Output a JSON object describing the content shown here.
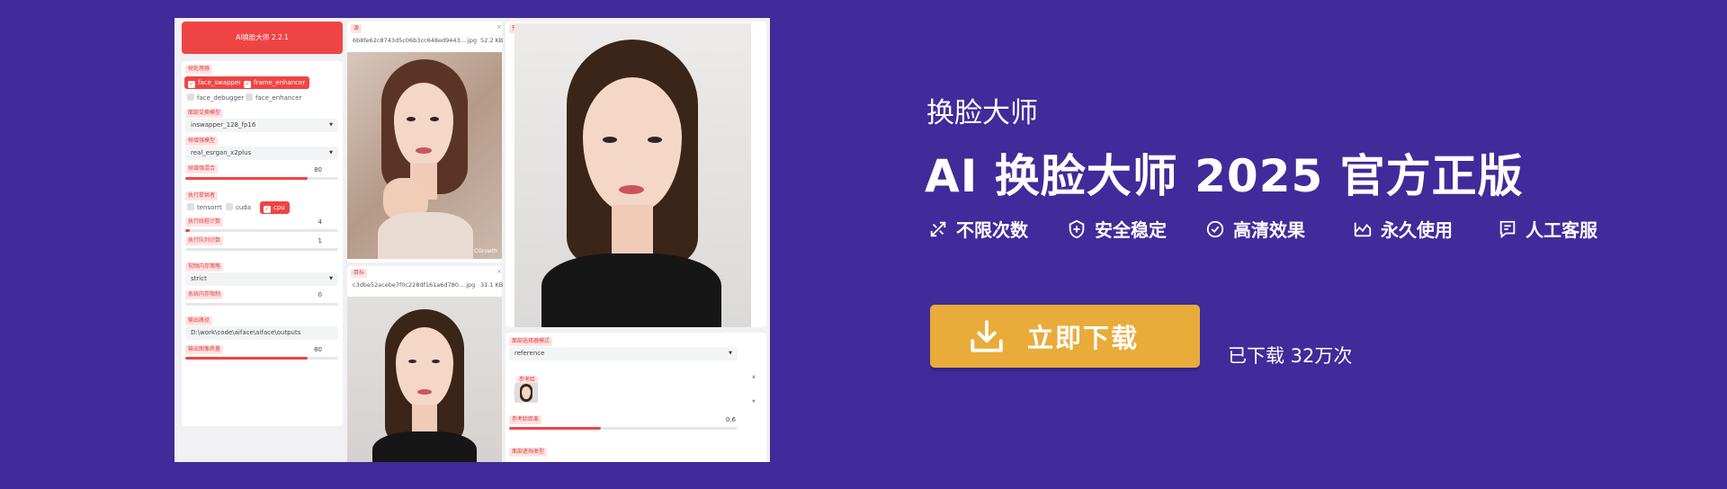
{
  "app": {
    "title": "AI换脸大师 2.2.1",
    "processors": {
      "label": "帧处理器",
      "items": [
        {
          "name": "face_swapper",
          "checked": true
        },
        {
          "name": "frame_enhancer",
          "checked": true
        },
        {
          "name": "face_debugger",
          "checked": false
        },
        {
          "name": "face_enhancer",
          "checked": false
        }
      ]
    },
    "swapper_model": {
      "label": "面部交换模型",
      "value": "inswapper_128_fp16"
    },
    "enhancer_model": {
      "label": "帧增强模型",
      "value": "real_esrgan_x2plus"
    },
    "enhancer_blend": {
      "label": "帧增强混合",
      "value": "80",
      "fraction": 0.8
    },
    "providers": {
      "label": "执行提供者",
      "items": [
        {
          "name": "tensorrt",
          "checked": false
        },
        {
          "name": "cuda",
          "checked": false
        },
        {
          "name": "cpu",
          "checked": true
        }
      ]
    },
    "thread_count": {
      "label": "执行线程计数",
      "value": "4",
      "fraction": 0.03
    },
    "queue_count": {
      "label": "执行队列计数",
      "value": "1",
      "fraction": 0.0
    },
    "memory_strategy": {
      "label": "视频内存策略",
      "value": "strict"
    },
    "memory_limit": {
      "label": "系统内存限制",
      "value": "0",
      "fraction": 0.0
    },
    "output_path": {
      "label": "输出路径",
      "value": "D:\\work\\code\\aiface\\aiface\\outputs"
    },
    "output_quality": {
      "label": "输出图像质量",
      "value": "80",
      "fraction": 0.8
    },
    "source": {
      "label": "源",
      "filename": "6b8fe62c8743d5c06b3cc648ed9443....jpg",
      "size": "52.2 KB"
    },
    "target": {
      "label": "目标",
      "filename": "c3dbe52acebe7f0c228df161a6d780....jpg",
      "size": "31.1 KB"
    },
    "preview": {
      "label": "预览"
    },
    "face_selector": {
      "label": "面部选择器模式",
      "value": "reference"
    },
    "reference": {
      "label": "参考脸"
    },
    "ref_distance": {
      "label": "参考脸距离",
      "value": "0.6",
      "fraction": 0.4
    },
    "face_mask": {
      "label": "面部遮挡类型"
    },
    "watermark": "CGrowth"
  },
  "promo": {
    "subtitle": "换脸大师",
    "title": "AI 换脸大师 2025 官方正版",
    "features": [
      {
        "icon": "tools-icon",
        "label": "不限次数"
      },
      {
        "icon": "shield-icon",
        "label": "安全稳定"
      },
      {
        "icon": "check-circle-icon",
        "label": "高清效果"
      },
      {
        "icon": "chart-icon",
        "label": "永久使用"
      },
      {
        "icon": "message-icon",
        "label": "人工客服"
      }
    ],
    "download_label": "立即下载",
    "download_count": "已下载 32万次"
  },
  "colors": {
    "background": "#402b9a",
    "accent_red": "#ef4444",
    "button": "#e9ab3a"
  }
}
